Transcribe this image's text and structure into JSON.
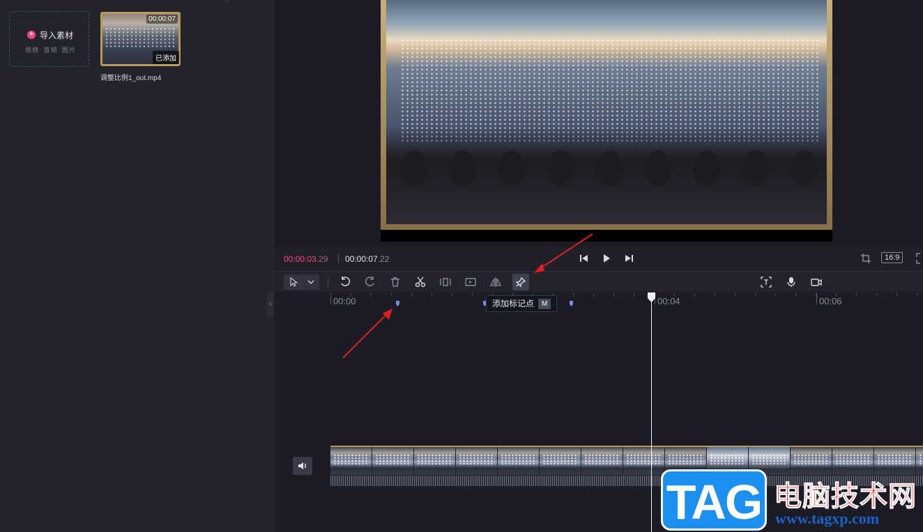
{
  "media_panel": {
    "top_text": "...",
    "import": {
      "label": "导入素材",
      "sub_label": "视频 音频 图片"
    },
    "clip": {
      "duration": "00:00:07",
      "status": "已添加",
      "file_name": "调整比例1_out.mp4"
    }
  },
  "playback": {
    "current_main": "00:00:03",
    "current_frac": ".29",
    "total_main": "00:00:07",
    "total_frac": ".22",
    "aspect_ratio": "16:9"
  },
  "timeline": {
    "ticks": [
      "00:00",
      "00:04",
      "00:06"
    ],
    "tooltip": {
      "label": "添加标记点",
      "shortcut": "M"
    }
  },
  "watermark": {
    "tag": "TAG",
    "cn": "电脑技术网",
    "url": "www.tagxp.com"
  },
  "colors": {
    "accent": "#f0487a",
    "marker": "#7b86ee",
    "arrow": "#e01f1f"
  }
}
